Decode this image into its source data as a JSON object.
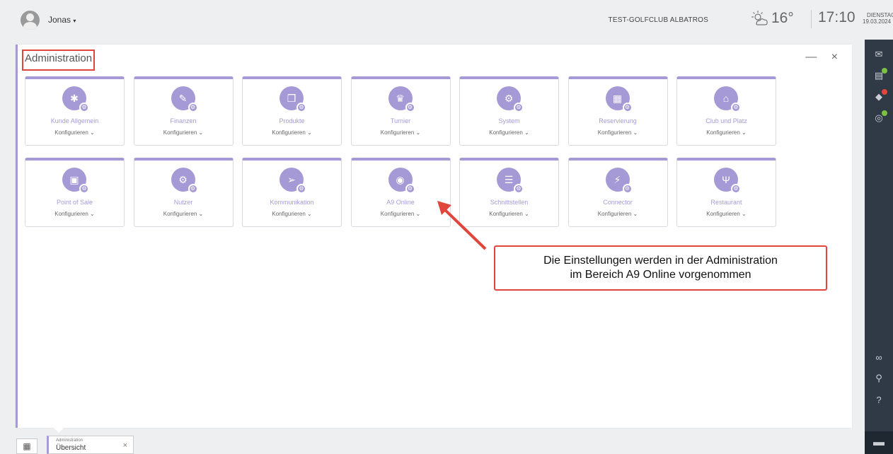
{
  "header": {
    "user": "Jonas",
    "club": "TEST-GOLFCLUB ALBATROS",
    "temperature": "16°",
    "time": "17:10",
    "weekday": "DIENSTAG",
    "date": "19.03.2024"
  },
  "panel": {
    "title": "Administration",
    "minimize": "—",
    "close": "×"
  },
  "configure_label": "Konfigurieren",
  "tiles_row1": [
    {
      "label": "Kunde Allgemein",
      "icon": "bug-icon",
      "glyph": "✱"
    },
    {
      "label": "Finanzen",
      "icon": "tag-icon",
      "glyph": "✎"
    },
    {
      "label": "Produkte",
      "icon": "box-icon",
      "glyph": "❒"
    },
    {
      "label": "Turnier",
      "icon": "trophy-icon",
      "glyph": "♛"
    },
    {
      "label": "System",
      "icon": "cogs-icon",
      "glyph": "⚙"
    },
    {
      "label": "Reservierung",
      "icon": "calendar-icon",
      "glyph": "▦"
    },
    {
      "label": "Club und Platz",
      "icon": "bank-icon",
      "glyph": "⌂"
    }
  ],
  "tiles_row2": [
    {
      "label": "Point of Sale",
      "icon": "basket-icon",
      "glyph": "▣"
    },
    {
      "label": "Nutzer",
      "icon": "cogs-icon",
      "glyph": "⚙"
    },
    {
      "label": "Kommunikation",
      "icon": "paper-plane-icon",
      "glyph": "➢"
    },
    {
      "label": "A9 Online",
      "icon": "safe-icon",
      "glyph": "◉"
    },
    {
      "label": "Schnittstellen",
      "icon": "list-icon",
      "glyph": "☰"
    },
    {
      "label": "Connector",
      "icon": "plug-icon",
      "glyph": "⚡"
    },
    {
      "label": "Restaurant",
      "icon": "cutlery-icon",
      "glyph": "Ψ"
    }
  ],
  "callout": {
    "line1": "Die Einstellungen werden in der Administration",
    "line2": "im Bereich A9 Online vorgenommen"
  },
  "taskbar": {
    "tab_small": "Administration",
    "tab_main": "Übersicht",
    "tab_close": "×"
  },
  "colors": {
    "accent": "#a59ad6",
    "highlight": "#e1463c",
    "sidebar": "#2f3a46"
  }
}
